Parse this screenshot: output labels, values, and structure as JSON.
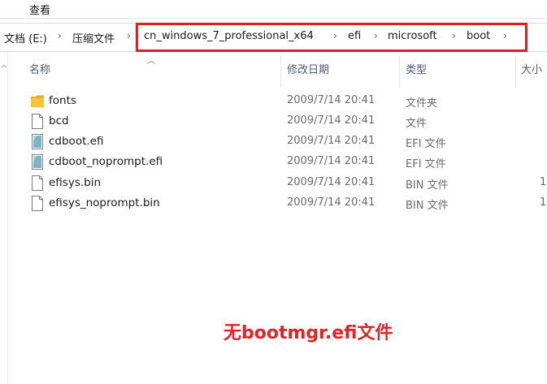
{
  "menubar": {
    "view_label": "查看"
  },
  "address": {
    "crumbs": [
      "文档 (E:)",
      "压缩文件",
      "cn_windows_7_professional_x64",
      "efi",
      "microsoft",
      "boot"
    ]
  },
  "columns": {
    "name": "名称",
    "modified": "修改日期",
    "type": "类型",
    "size": "大小"
  },
  "files": [
    {
      "name": "fonts",
      "modified": "2009/7/14 20:41",
      "type": "文件夹",
      "size": "",
      "icon": "folder-icon"
    },
    {
      "name": "bcd",
      "modified": "2009/7/14 20:41",
      "type": "文件",
      "size": "",
      "icon": "file-icon"
    },
    {
      "name": "cdboot.efi",
      "modified": "2009/7/14 20:41",
      "type": "EFI 文件",
      "size": "",
      "icon": "efi-file-icon"
    },
    {
      "name": "cdboot_noprompt.efi",
      "modified": "2009/7/14 20:41",
      "type": "EFI 文件",
      "size": "",
      "icon": "efi-file-icon"
    },
    {
      "name": "efisys.bin",
      "modified": "2009/7/14 20:41",
      "type": "BIN 文件",
      "size": "1,",
      "icon": "file-icon"
    },
    {
      "name": "efisys_noprompt.bin",
      "modified": "2009/7/14 20:41",
      "type": "BIN 文件",
      "size": "1,",
      "icon": "file-icon"
    }
  ],
  "caption": "无bootmgr.efi文件",
  "colors": {
    "highlight": "#e02020",
    "caption": "#e0242a",
    "folder": "#f5c342",
    "efi_icon": "#7fb2c8"
  }
}
